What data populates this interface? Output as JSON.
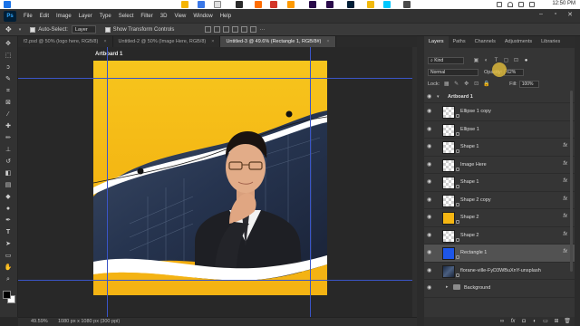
{
  "titlebar": {
    "clock": "12:50 PM"
  },
  "menu": {
    "app_abbrev": "Ps",
    "items": [
      "File",
      "Edit",
      "Image",
      "Layer",
      "Type",
      "Select",
      "Filter",
      "3D",
      "View",
      "Window",
      "Help"
    ]
  },
  "options": {
    "auto_select_label": "Auto-Select:",
    "auto_select_target": "Layer",
    "show_transform_label": "Show Transform Controls"
  },
  "doc_tabs": [
    {
      "label": "f2.psd @ 50% (logo here, RGB/8)",
      "active": false
    },
    {
      "label": "Untitled-2 @ 50% (Image Here, RGB/8)",
      "active": false
    },
    {
      "label": "Untitled-3 @ 49.6% (Rectangle 1, RGB/8#)",
      "active": true
    }
  ],
  "canvas": {
    "artboard_label": "Artboard 1"
  },
  "status": {
    "zoom": "49.59%",
    "doc_size": "1080 px x 1080 px (300 ppi)"
  },
  "panel": {
    "tabs": [
      "Layers",
      "Paths",
      "Channels",
      "Adjustments",
      "Libraries"
    ],
    "filter_kind": "Kind",
    "blend_mode": "Normal",
    "opacity_label": "Opacity:",
    "opacity_value": "62%",
    "lock_label": "Lock:",
    "fill_label": "Fill:",
    "fill_value": "100%",
    "artboard_group": "Artboard 1",
    "layers": [
      {
        "name": "Ellipse 1 copy",
        "thumb": "checker",
        "fx": false
      },
      {
        "name": "Ellipse 1",
        "thumb": "checker",
        "fx": false
      },
      {
        "name": "Shape 1",
        "thumb": "checker",
        "fx": true
      },
      {
        "name": "Image Here",
        "thumb": "checker",
        "fx": true
      },
      {
        "name": "Shape 1",
        "thumb": "checker",
        "fx": true
      },
      {
        "name": "Shape 2 copy",
        "thumb": "checker",
        "fx": true
      },
      {
        "name": "Shape 2",
        "thumb": "yellow",
        "fx": true
      },
      {
        "name": "Shape 2",
        "thumb": "checker",
        "fx": true
      },
      {
        "name": "Rectangle 1",
        "thumb": "blue",
        "fx": true,
        "selected": true
      },
      {
        "name": "florane-ville-FyD3WBuXnY-unsplash",
        "thumb": "photo",
        "fx": false
      },
      {
        "name": "Background",
        "thumb": "folder",
        "fx": false
      }
    ]
  },
  "colors": {
    "accent_yellow": "#F5B613",
    "guide_blue": "#3A55C8",
    "selected_layer_blue": "#1D56E8"
  },
  "icons": {
    "fx": "fx"
  }
}
